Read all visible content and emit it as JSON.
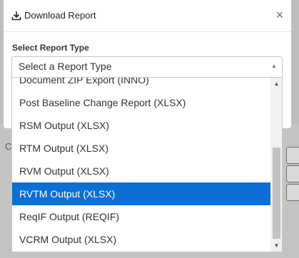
{
  "dialog": {
    "title": "Download Report",
    "close_label": "×",
    "field_label": "Select Report Type"
  },
  "select": {
    "placeholder": "Select a Report Type",
    "arrow": "▲"
  },
  "options": [
    {
      "label": "Document ZIP Export (INNO)",
      "selected": false
    },
    {
      "label": "Post Baseline Change Report (XLSX)",
      "selected": false
    },
    {
      "label": "RSM Output (XLSX)",
      "selected": false
    },
    {
      "label": "RTM Output (XLSX)",
      "selected": false
    },
    {
      "label": "RVM Output (XLSX)",
      "selected": false
    },
    {
      "label": "RVTM Output (XLSX)",
      "selected": true
    },
    {
      "label": "ReqIF Output (REQIF)",
      "selected": false
    },
    {
      "label": "VCRM Output (XLSX)",
      "selected": false
    }
  ],
  "scrollbar": {
    "up": "▲",
    "down": "▼",
    "position_fraction": 0.85
  },
  "background": {
    "letter": "C"
  }
}
